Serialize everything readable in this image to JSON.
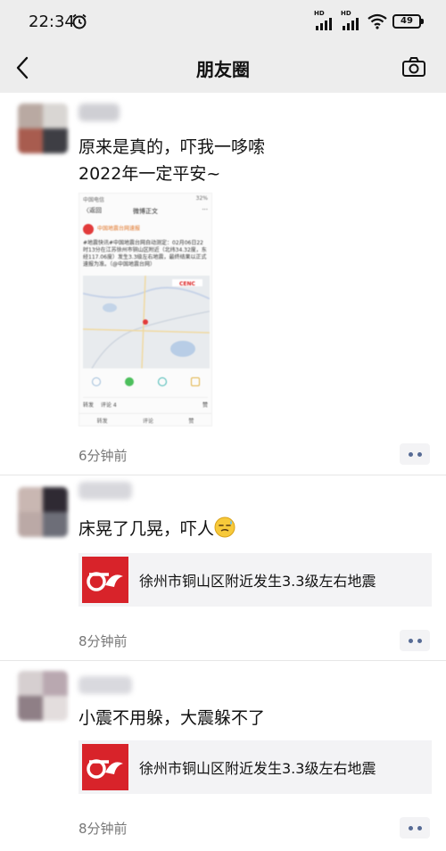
{
  "status_bar": {
    "time": "22:34",
    "battery": "49",
    "icons": [
      "alarm-icon",
      "signal-hd-icon",
      "signal-hd-icon",
      "wifi-icon",
      "battery-icon"
    ]
  },
  "nav": {
    "title": "朋友圈",
    "back_icon": "chevron-left-icon",
    "camera_icon": "camera-icon"
  },
  "posts": [
    {
      "text": "原来是真的，吓我一哆嗦\n2022年一定平安~",
      "time": "6分钟前",
      "image": {
        "status_left": "中国电信",
        "status_right": "32%",
        "back_label": "〈返回",
        "page_title": "微博正文",
        "account": "中国地震台网速报",
        "body": "#地震快讯#中国地震台网自动测定：02月06日22时13分在江苏徐州市铜山区附近（北纬34.32度，东经117.06度）发生3.3级左右地震，最终结果以正式速报为准。（@中国地震台网）",
        "map_logo": "CENC",
        "tabs": [
          "转发",
          "评论 4",
          "赞"
        ],
        "bottom": [
          "转发",
          "评论",
          "赞"
        ]
      }
    },
    {
      "text": "床晃了几晃，吓人",
      "emoji": "sweat-emoji",
      "link": "徐州市铜山区附近发生3.3级左右地震",
      "time": "8分钟前"
    },
    {
      "text": "小震不用躲，大震躲不了",
      "link": "徐州市铜山区附近发生3.3级左右地震",
      "time": "8分钟前"
    }
  ],
  "colors": {
    "header_bg": "#ededed",
    "link_card_bg": "#f3f3f5",
    "link_thumb_red": "#d8232a",
    "more_dots": "#576b95"
  }
}
